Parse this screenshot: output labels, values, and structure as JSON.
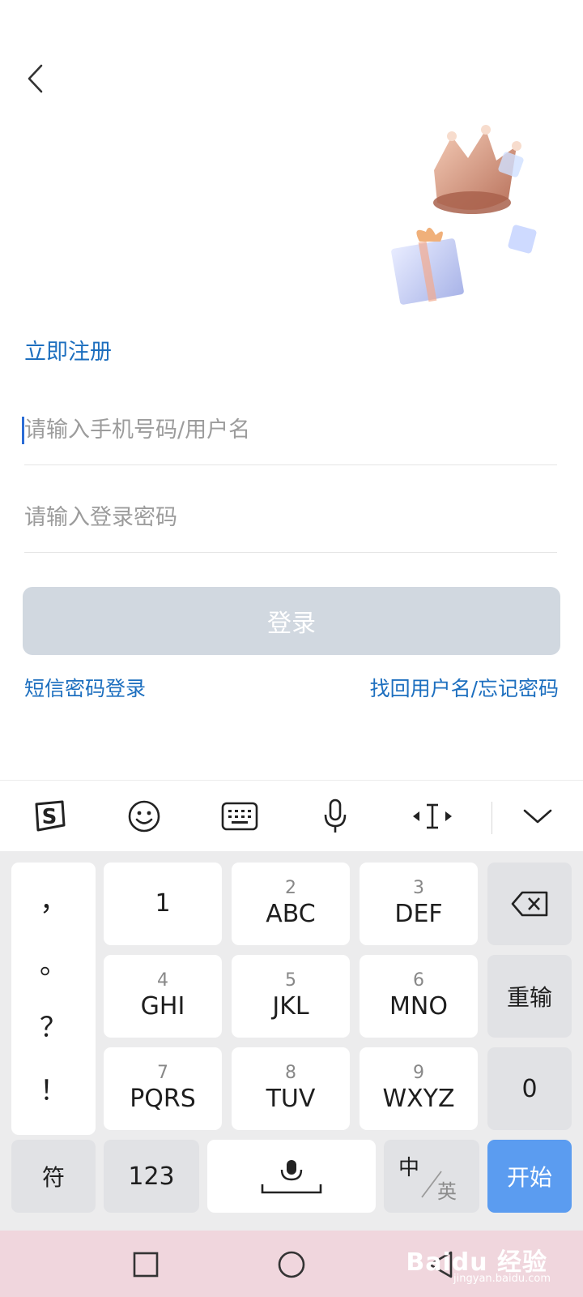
{
  "header": {
    "back_icon": "chevron-left-icon"
  },
  "hero": {
    "icons": [
      "crown-icon",
      "gift-box-icon",
      "small-cube-icon"
    ]
  },
  "register": {
    "label": "立即注册"
  },
  "form": {
    "username": {
      "value": "",
      "placeholder": "请输入手机号码/用户名"
    },
    "password": {
      "value": "",
      "placeholder": "请输入登录密码"
    },
    "login_label": "登录",
    "login_enabled": false
  },
  "links": {
    "sms_login": "短信密码登录",
    "forgot": "找回用户名/忘记密码"
  },
  "keyboard": {
    "toolbar": [
      "sogou-logo-icon",
      "emoji-icon",
      "keyboard-icon",
      "microphone-icon",
      "cursor-move-icon",
      "chevron-down-icon"
    ],
    "punctuation": [
      "，",
      "。",
      "？",
      "！"
    ],
    "keys": [
      {
        "num": "",
        "letters": "1"
      },
      {
        "num": "2",
        "letters": "ABC"
      },
      {
        "num": "3",
        "letters": "DEF"
      },
      {
        "num": "4",
        "letters": "GHI"
      },
      {
        "num": "5",
        "letters": "JKL"
      },
      {
        "num": "6",
        "letters": "MNO"
      },
      {
        "num": "7",
        "letters": "PQRS"
      },
      {
        "num": "8",
        "letters": "TUV"
      },
      {
        "num": "9",
        "letters": "WXYZ"
      }
    ],
    "reinput": "重输",
    "zero": "0",
    "symbol": "符",
    "num_mode": "123",
    "lang_cn": "中",
    "lang_en": "英",
    "start": "开始"
  },
  "navbar": {
    "icons": [
      "square-icon",
      "circle-icon",
      "triangle-back-icon"
    ]
  },
  "watermark": {
    "text": "Baidu 经验",
    "sub": "jingyan.baidu.com"
  },
  "colors": {
    "link": "#1d6fbf",
    "button_disabled": "#d1d8e0",
    "keyboard_accent": "#5b9cf0"
  }
}
